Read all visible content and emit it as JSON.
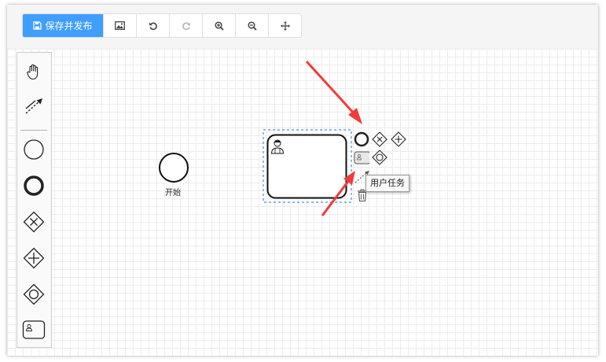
{
  "toolbar": {
    "save_label": "保存并发布",
    "buttons": [
      "image-icon",
      "undo-icon",
      "redo-icon",
      "zoom-in-icon",
      "zoom-out-icon",
      "move-icon"
    ]
  },
  "palette": {
    "tools": [
      "hand-tool-icon",
      "global-connect-icon",
      "start-event-icon",
      "end-event-icon",
      "exclusive-gateway-icon",
      "parallel-gateway-icon",
      "inclusive-gateway-icon",
      "user-task-icon"
    ]
  },
  "diagram": {
    "start_event_label": "开始"
  },
  "context_pad": {
    "tooltip": "用户任务"
  },
  "colors": {
    "primary": "#409eff",
    "arrow": "#f03c3c",
    "selection": "#4a90d9"
  }
}
